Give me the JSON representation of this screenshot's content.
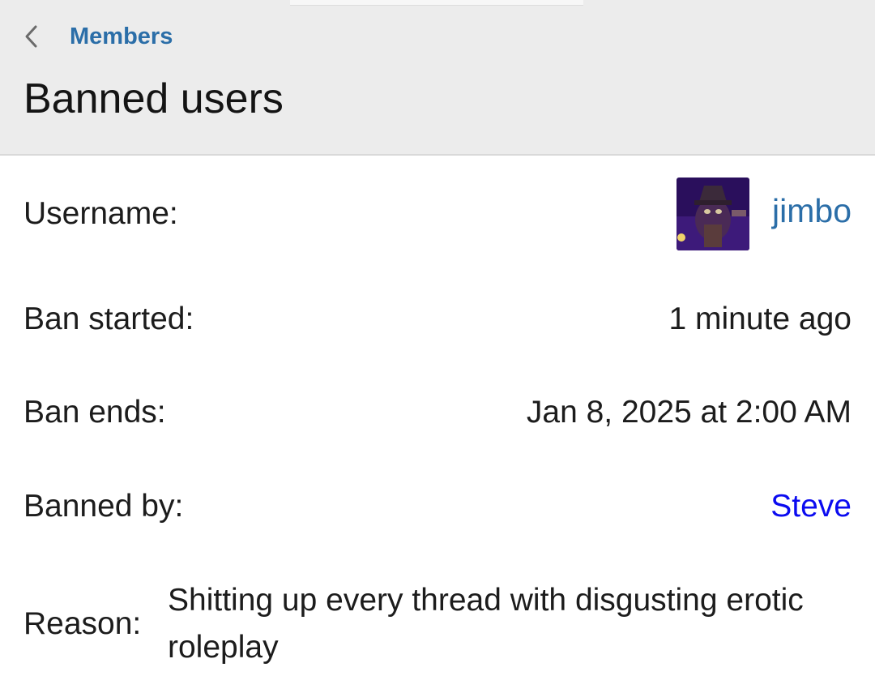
{
  "header": {
    "breadcrumb_label": "Members",
    "title": "Banned users"
  },
  "details": {
    "username_label": "Username:",
    "username": "jimbo",
    "ban_started_label": "Ban started:",
    "ban_started": "1 minute ago",
    "ban_ends_label": "Ban ends:",
    "ban_ends": "Jan 8, 2025 at 2:00 AM",
    "banned_by_label": "Banned by:",
    "banned_by": "Steve",
    "reason_label": "Reason:",
    "reason": "Shitting up every thread with disgusting erotic roleplay"
  },
  "colors": {
    "header_bg": "#ececec",
    "link_blue": "#2b6ea8",
    "banned_by_blue": "#0b0bf0",
    "text": "#1c1c1c"
  },
  "icons": {
    "back": "chevron-left-icon",
    "avatar": "user-avatar"
  }
}
